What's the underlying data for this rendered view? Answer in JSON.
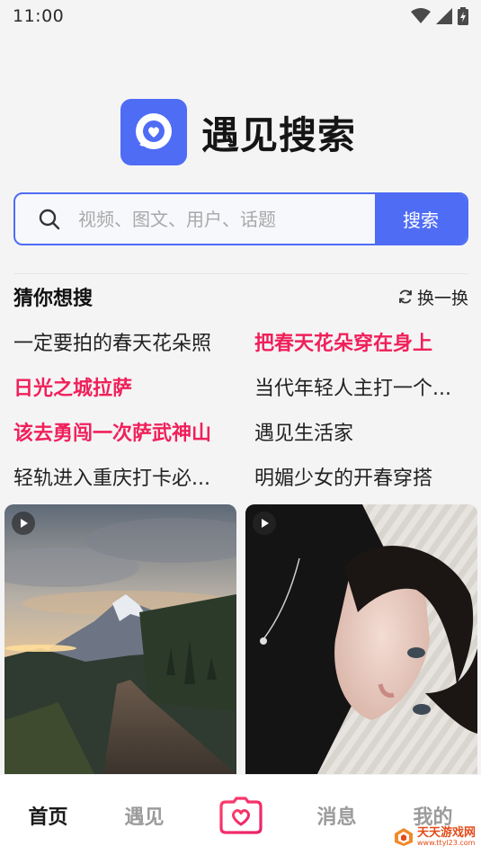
{
  "status": {
    "time": "11:00"
  },
  "brand": {
    "name": "遇见搜索",
    "logo_icon": "heart-chat-icon",
    "color": "#4f6cf5"
  },
  "search": {
    "placeholder": "视频、图文、用户、话题",
    "button": "搜索"
  },
  "suggestions": {
    "title": "猜你想搜",
    "refresh": "换一换",
    "hot_color": "#f0205a",
    "items": [
      {
        "text": "一定要拍的春天花朵照",
        "hot": false
      },
      {
        "text": "把春天花朵穿在身上",
        "hot": true
      },
      {
        "text": "日光之城拉萨",
        "hot": true
      },
      {
        "text": "当代年轻人主打一个...",
        "hot": false
      },
      {
        "text": "该去勇闯一次萨武神山",
        "hot": true
      },
      {
        "text": "遇见生活家",
        "hot": false
      },
      {
        "text": "轻轨进入重庆打卡必...",
        "hot": false
      },
      {
        "text": "明媚少女的开春穿搭",
        "hot": false
      }
    ]
  },
  "feed": [
    {
      "type": "video",
      "subject": "mountain-trail-sunset"
    },
    {
      "type": "video",
      "subject": "portrait-woman-lying"
    }
  ],
  "tabbar": {
    "tabs": [
      "首页",
      "遇见",
      "消息",
      "我的"
    ],
    "active": "首页",
    "center_icon": "camera-heart-icon"
  },
  "watermark": {
    "text": "天天游戏网",
    "url": "www.ttyl23.com"
  }
}
